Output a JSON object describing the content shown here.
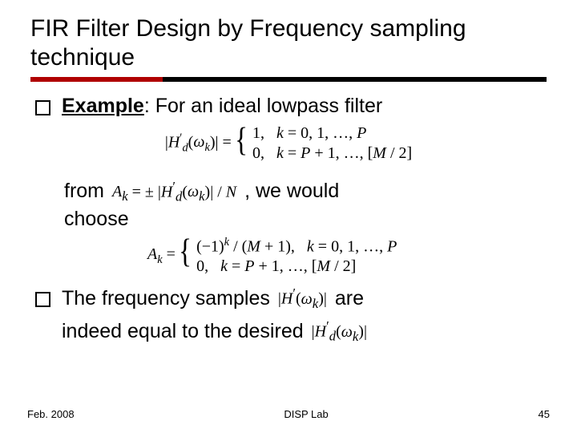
{
  "title": "FIR Filter Design by Frequency sampling technique",
  "bullets": {
    "b1_lead": "Example",
    "b1_rest": ": For an ideal lowpass filter",
    "from": "from",
    "we_would": ", we would",
    "choose": "choose",
    "b2_a": "The frequency samples",
    "b2_b": "are",
    "b2_c": "indeed equal to the desired"
  },
  "math": {
    "eq1_lhs": "|H′_d(ω_k)| =",
    "eq1_c1": "1,   k = 0, 1, …, P",
    "eq1_c2": "0,   k = P + 1, …, [M / 2]",
    "eq2": "A_k = ± |H′_d(ω_k)| / N",
    "eq3_lhs": "A_k =",
    "eq3_c1": "(−1)^k / (M + 1),   k = 0, 1, …, P",
    "eq3_c2": "0,   k = P + 1, …, [M / 2]",
    "inl1": "|H′(ω_k)|",
    "inl2": "|H′_d(ω_k)|"
  },
  "footer": {
    "left": "Feb. 2008",
    "center": "DISP Lab",
    "right": "45"
  }
}
